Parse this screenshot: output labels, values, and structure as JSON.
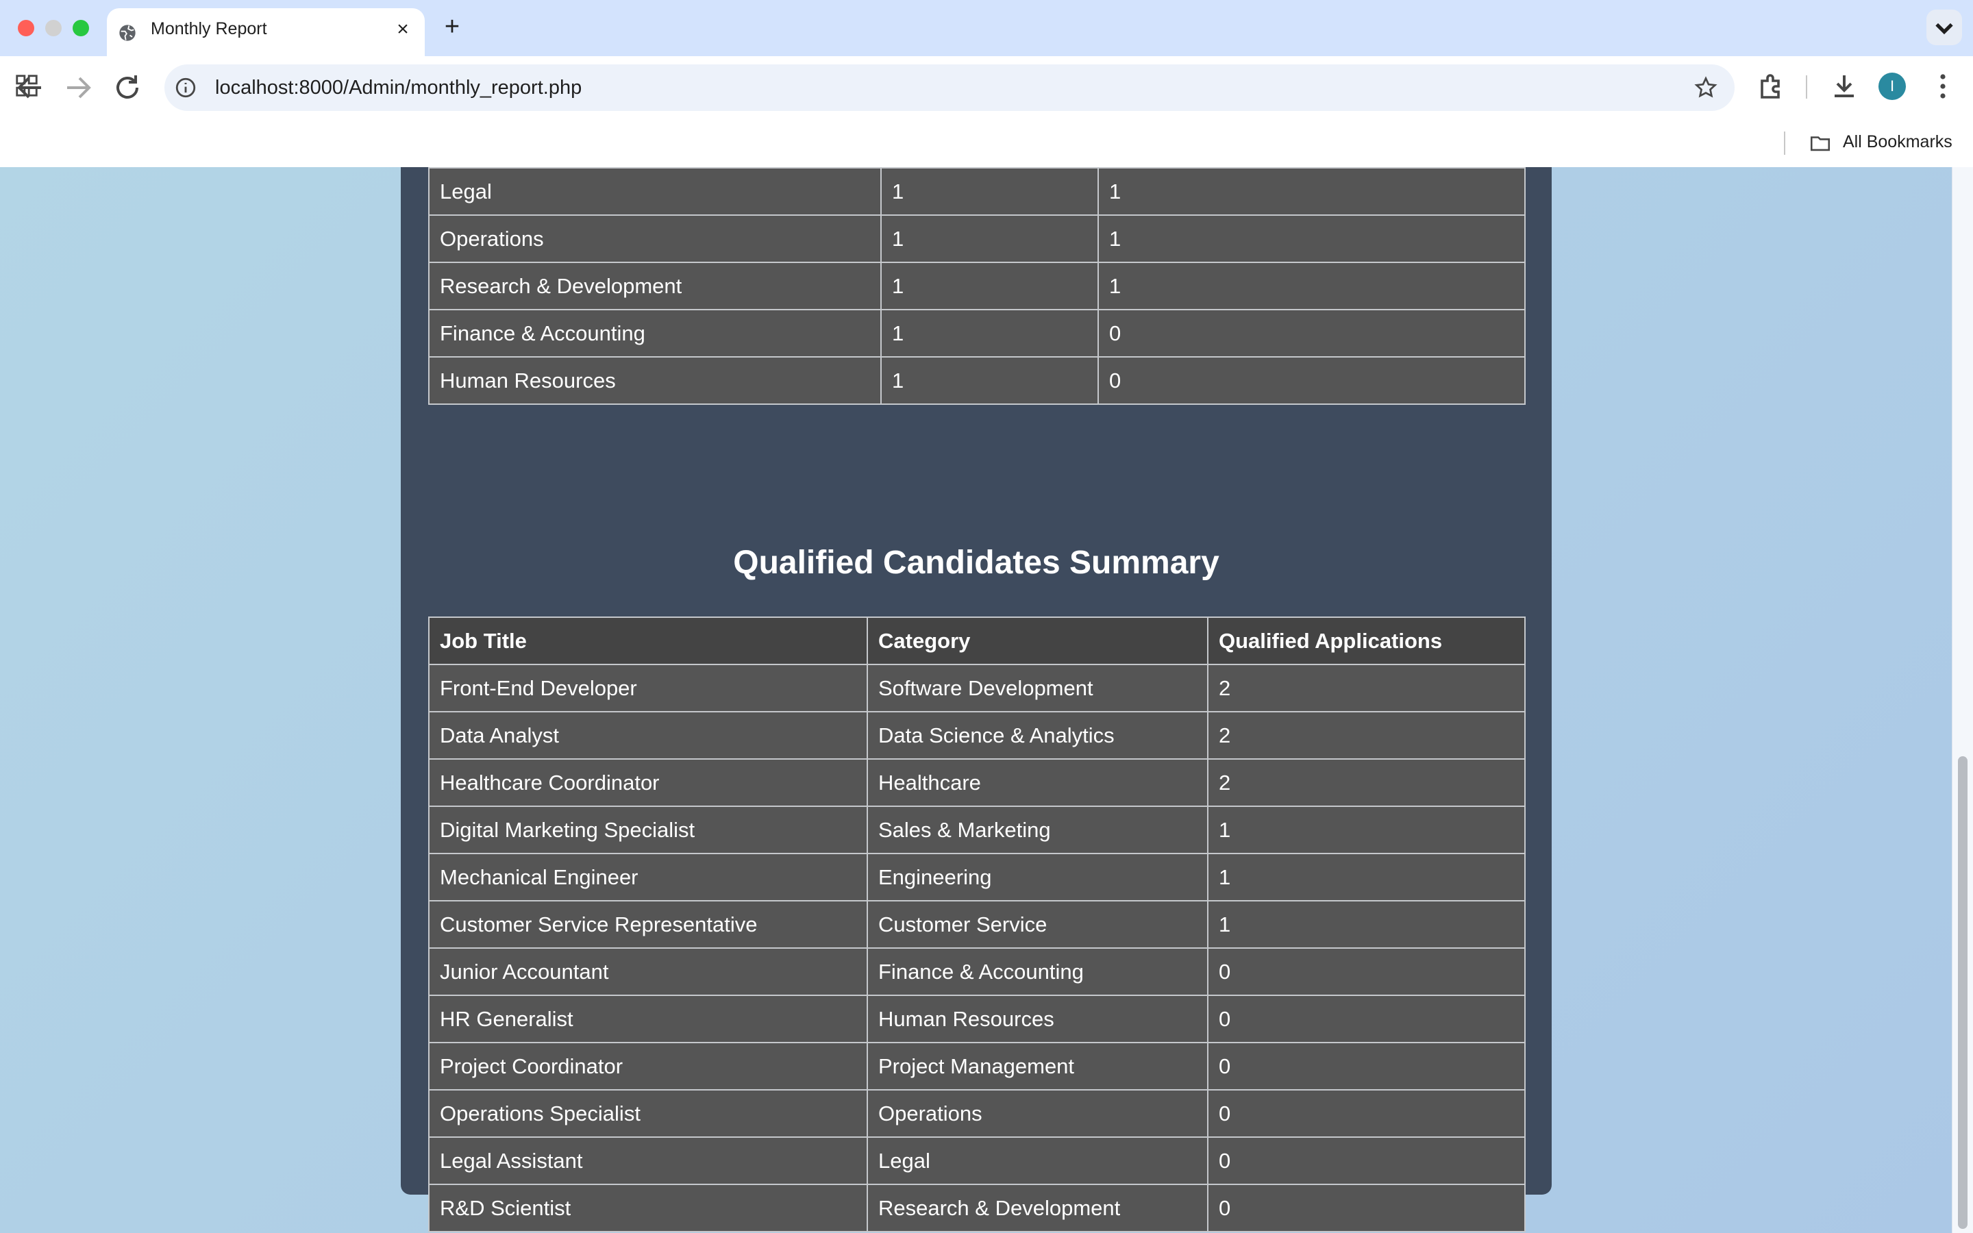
{
  "browser": {
    "tab_title": "Monthly Report",
    "url": "localhost:8000/Admin/monthly_report.php",
    "avatar_initial": "I",
    "bookmarks_label": "All Bookmarks"
  },
  "department_rows": [
    [
      "Legal",
      "1",
      "1"
    ],
    [
      "Operations",
      "1",
      "1"
    ],
    [
      "Research & Development",
      "1",
      "1"
    ],
    [
      "Finance & Accounting",
      "1",
      "0"
    ],
    [
      "Human Resources",
      "1",
      "0"
    ]
  ],
  "qualified_summary": {
    "title": "Qualified Candidates Summary",
    "headers": [
      "Job Title",
      "Category",
      "Qualified Applications"
    ],
    "rows": [
      [
        "Front-End Developer",
        "Software Development",
        "2"
      ],
      [
        "Data Analyst",
        "Data Science & Analytics",
        "2"
      ],
      [
        "Healthcare Coordinator",
        "Healthcare",
        "2"
      ],
      [
        "Digital Marketing Specialist",
        "Sales & Marketing",
        "1"
      ],
      [
        "Mechanical Engineer",
        "Engineering",
        "1"
      ],
      [
        "Customer Service Representative",
        "Customer Service",
        "1"
      ],
      [
        "Junior Accountant",
        "Finance & Accounting",
        "0"
      ],
      [
        "HR Generalist",
        "Human Resources",
        "0"
      ],
      [
        "Project Coordinator",
        "Project Management",
        "0"
      ],
      [
        "Operations Specialist",
        "Operations",
        "0"
      ],
      [
        "Legal Assistant",
        "Legal",
        "0"
      ],
      [
        "R&D Scientist",
        "Research & Development",
        "0"
      ]
    ]
  }
}
